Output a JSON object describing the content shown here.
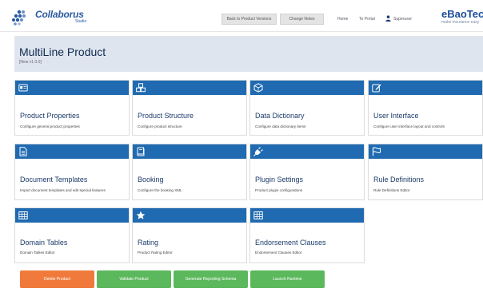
{
  "header": {
    "logo_text": "Collaborus",
    "logo_sub": "Studio",
    "back_button": "Back to Product Versions",
    "change_notes_button": "Change Notes",
    "home_link": "Home",
    "portal_link": "To Portal",
    "user_link": "Superuser",
    "brand": "eBaoTech",
    "brand_tagline": "make insurance easy"
  },
  "page": {
    "title": "MultiLine Product",
    "version": "[New v1.0.0]"
  },
  "cards": [
    {
      "title": "Product Properties",
      "desc": "Configure general product properties",
      "icon": "id-card-icon"
    },
    {
      "title": "Product Structure",
      "desc": "Configure product structure",
      "icon": "cubes-icon"
    },
    {
      "title": "Data Dictionary",
      "desc": "Configure data dictionary items",
      "icon": "cube-icon"
    },
    {
      "title": "User Interface",
      "desc": "Configure user interface layout and controls",
      "icon": "edit-icon"
    },
    {
      "title": "Document Templates",
      "desc": "Import document templates and edit special features",
      "icon": "document-icon"
    },
    {
      "title": "Booking",
      "desc": "Configure the booking XML",
      "icon": "book-icon"
    },
    {
      "title": "Plugin Settings",
      "desc": "Product plugin configurations",
      "icon": "plug-icon"
    },
    {
      "title": "Rule Definitions",
      "desc": "Rule Definitions Editor",
      "icon": "flag-icon"
    },
    {
      "title": "Domain Tables",
      "desc": "Domain Tables Editor",
      "icon": "table-icon"
    },
    {
      "title": "Rating",
      "desc": "Product Rating Editor",
      "icon": "star-icon"
    },
    {
      "title": "Endorsement Clauses",
      "desc": "Endorsement Clauses Editor",
      "icon": "table-icon"
    }
  ],
  "actions": {
    "delete": "Delete Product",
    "validate": "Validate Product",
    "generate": "Generate Reporting Schema",
    "launch": "Launch Runtime"
  },
  "colors": {
    "card_bar": "#1f6ab0",
    "delete": "#f07a3c",
    "green": "#5cb85c"
  }
}
